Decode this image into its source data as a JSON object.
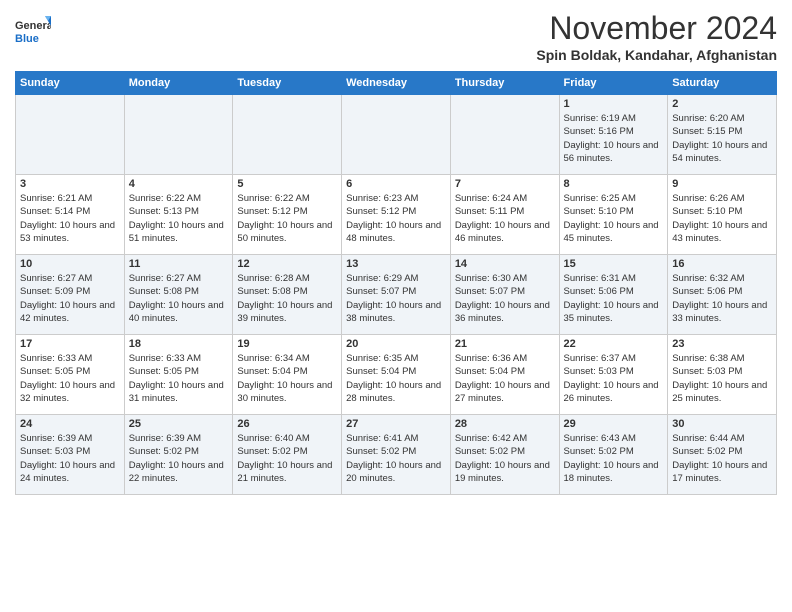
{
  "logo": {
    "line1": "General",
    "line2": "Blue"
  },
  "title": "November 2024",
  "location": "Spin Boldak, Kandahar, Afghanistan",
  "days_of_week": [
    "Sunday",
    "Monday",
    "Tuesday",
    "Wednesday",
    "Thursday",
    "Friday",
    "Saturday"
  ],
  "weeks": [
    [
      {
        "day": "",
        "info": ""
      },
      {
        "day": "",
        "info": ""
      },
      {
        "day": "",
        "info": ""
      },
      {
        "day": "",
        "info": ""
      },
      {
        "day": "",
        "info": ""
      },
      {
        "day": "1",
        "info": "Sunrise: 6:19 AM\nSunset: 5:16 PM\nDaylight: 10 hours and 56 minutes."
      },
      {
        "day": "2",
        "info": "Sunrise: 6:20 AM\nSunset: 5:15 PM\nDaylight: 10 hours and 54 minutes."
      }
    ],
    [
      {
        "day": "3",
        "info": "Sunrise: 6:21 AM\nSunset: 5:14 PM\nDaylight: 10 hours and 53 minutes."
      },
      {
        "day": "4",
        "info": "Sunrise: 6:22 AM\nSunset: 5:13 PM\nDaylight: 10 hours and 51 minutes."
      },
      {
        "day": "5",
        "info": "Sunrise: 6:22 AM\nSunset: 5:12 PM\nDaylight: 10 hours and 50 minutes."
      },
      {
        "day": "6",
        "info": "Sunrise: 6:23 AM\nSunset: 5:12 PM\nDaylight: 10 hours and 48 minutes."
      },
      {
        "day": "7",
        "info": "Sunrise: 6:24 AM\nSunset: 5:11 PM\nDaylight: 10 hours and 46 minutes."
      },
      {
        "day": "8",
        "info": "Sunrise: 6:25 AM\nSunset: 5:10 PM\nDaylight: 10 hours and 45 minutes."
      },
      {
        "day": "9",
        "info": "Sunrise: 6:26 AM\nSunset: 5:10 PM\nDaylight: 10 hours and 43 minutes."
      }
    ],
    [
      {
        "day": "10",
        "info": "Sunrise: 6:27 AM\nSunset: 5:09 PM\nDaylight: 10 hours and 42 minutes."
      },
      {
        "day": "11",
        "info": "Sunrise: 6:27 AM\nSunset: 5:08 PM\nDaylight: 10 hours and 40 minutes."
      },
      {
        "day": "12",
        "info": "Sunrise: 6:28 AM\nSunset: 5:08 PM\nDaylight: 10 hours and 39 minutes."
      },
      {
        "day": "13",
        "info": "Sunrise: 6:29 AM\nSunset: 5:07 PM\nDaylight: 10 hours and 38 minutes."
      },
      {
        "day": "14",
        "info": "Sunrise: 6:30 AM\nSunset: 5:07 PM\nDaylight: 10 hours and 36 minutes."
      },
      {
        "day": "15",
        "info": "Sunrise: 6:31 AM\nSunset: 5:06 PM\nDaylight: 10 hours and 35 minutes."
      },
      {
        "day": "16",
        "info": "Sunrise: 6:32 AM\nSunset: 5:06 PM\nDaylight: 10 hours and 33 minutes."
      }
    ],
    [
      {
        "day": "17",
        "info": "Sunrise: 6:33 AM\nSunset: 5:05 PM\nDaylight: 10 hours and 32 minutes."
      },
      {
        "day": "18",
        "info": "Sunrise: 6:33 AM\nSunset: 5:05 PM\nDaylight: 10 hours and 31 minutes."
      },
      {
        "day": "19",
        "info": "Sunrise: 6:34 AM\nSunset: 5:04 PM\nDaylight: 10 hours and 30 minutes."
      },
      {
        "day": "20",
        "info": "Sunrise: 6:35 AM\nSunset: 5:04 PM\nDaylight: 10 hours and 28 minutes."
      },
      {
        "day": "21",
        "info": "Sunrise: 6:36 AM\nSunset: 5:04 PM\nDaylight: 10 hours and 27 minutes."
      },
      {
        "day": "22",
        "info": "Sunrise: 6:37 AM\nSunset: 5:03 PM\nDaylight: 10 hours and 26 minutes."
      },
      {
        "day": "23",
        "info": "Sunrise: 6:38 AM\nSunset: 5:03 PM\nDaylight: 10 hours and 25 minutes."
      }
    ],
    [
      {
        "day": "24",
        "info": "Sunrise: 6:39 AM\nSunset: 5:03 PM\nDaylight: 10 hours and 24 minutes."
      },
      {
        "day": "25",
        "info": "Sunrise: 6:39 AM\nSunset: 5:02 PM\nDaylight: 10 hours and 22 minutes."
      },
      {
        "day": "26",
        "info": "Sunrise: 6:40 AM\nSunset: 5:02 PM\nDaylight: 10 hours and 21 minutes."
      },
      {
        "day": "27",
        "info": "Sunrise: 6:41 AM\nSunset: 5:02 PM\nDaylight: 10 hours and 20 minutes."
      },
      {
        "day": "28",
        "info": "Sunrise: 6:42 AM\nSunset: 5:02 PM\nDaylight: 10 hours and 19 minutes."
      },
      {
        "day": "29",
        "info": "Sunrise: 6:43 AM\nSunset: 5:02 PM\nDaylight: 10 hours and 18 minutes."
      },
      {
        "day": "30",
        "info": "Sunrise: 6:44 AM\nSunset: 5:02 PM\nDaylight: 10 hours and 17 minutes."
      }
    ]
  ]
}
